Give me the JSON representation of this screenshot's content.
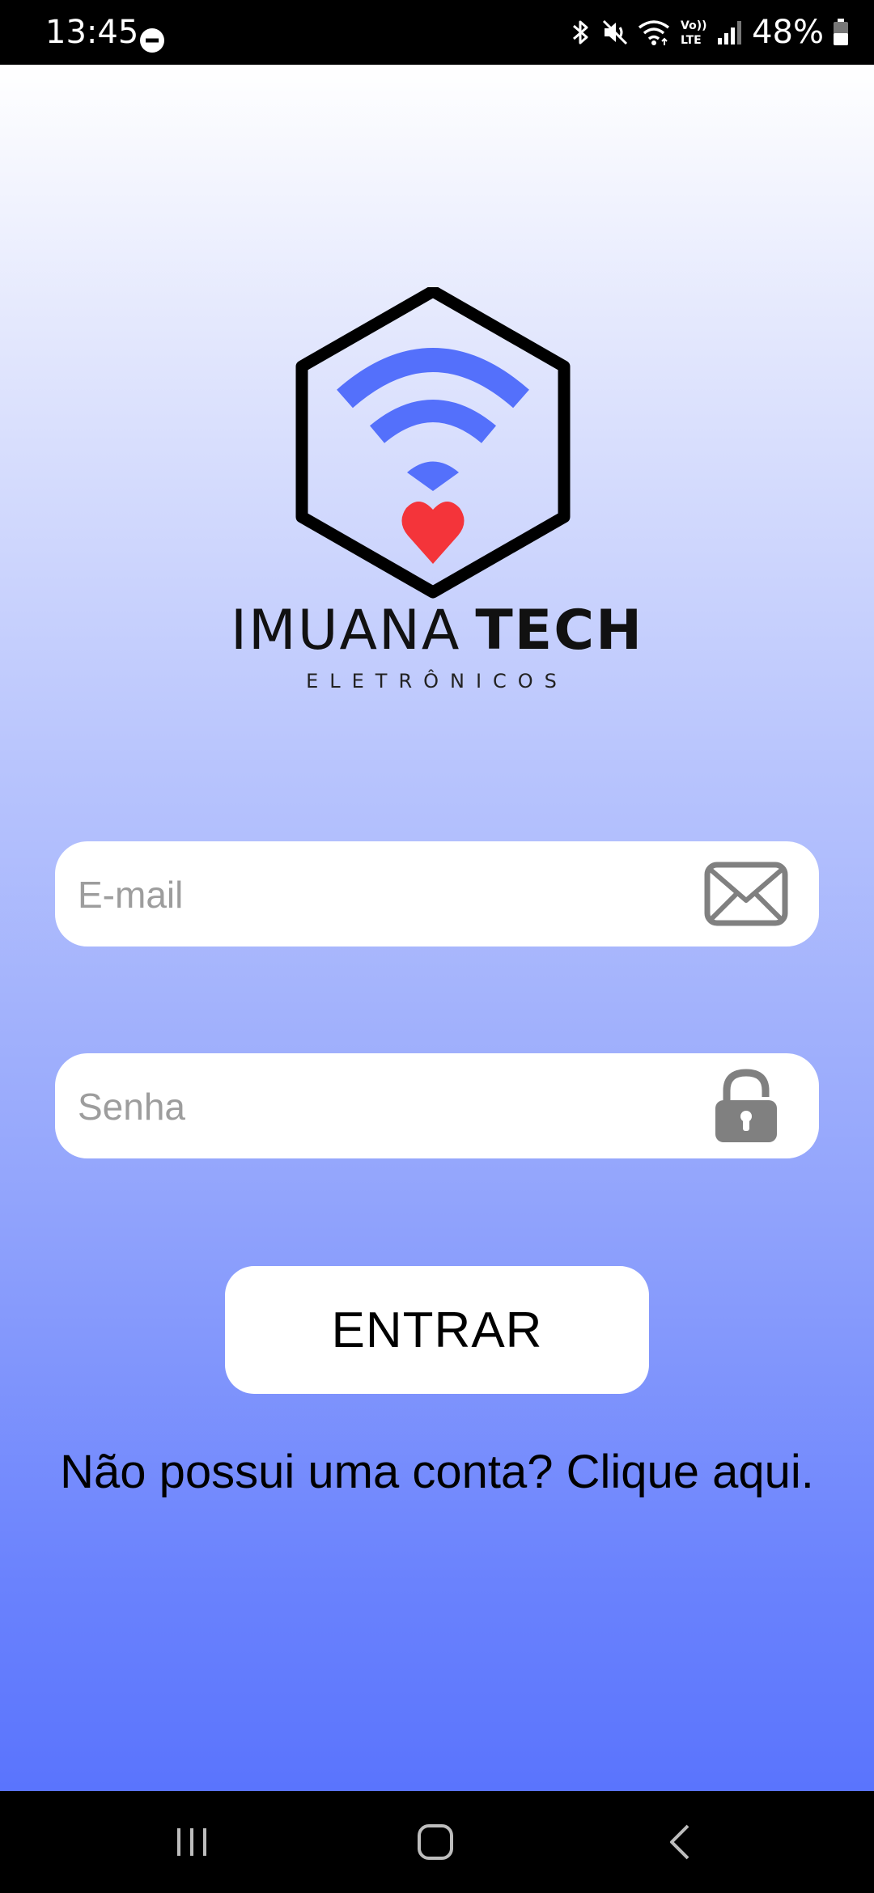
{
  "status_bar": {
    "time": "13:45",
    "battery": "48%",
    "icons": [
      "do-not-disturb-icon",
      "bluetooth-icon",
      "mute-icon",
      "wifi-icon",
      "volte-icon",
      "signal-icon",
      "battery-icon"
    ]
  },
  "brand": {
    "name_light": "IMUANA",
    "name_bold": "TECH",
    "tagline": "ELETRÔNICOS",
    "logo_colors": {
      "hexagon": "#000000",
      "wifi": "#5470fb",
      "heart": "#f4343a"
    }
  },
  "form": {
    "email_placeholder": "E-mail",
    "email_value": "",
    "email_icon": "envelope-icon",
    "password_placeholder": "Senha",
    "password_value": "",
    "password_icon": "lock-icon",
    "submit_label": "ENTRAR",
    "signup_text": "Não possui uma conta? Clique aqui."
  },
  "nav_bar": {
    "buttons": [
      "recents-icon",
      "home-icon",
      "back-icon"
    ]
  },
  "colors": {
    "gradient_top": "#ffffff",
    "gradient_bottom": "#5a74fd",
    "field_background": "#ffffff",
    "placeholder": "#9d9d9d",
    "icon_gray": "#808080"
  }
}
